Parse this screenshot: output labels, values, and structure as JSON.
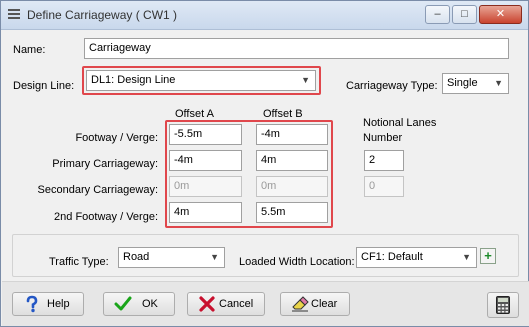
{
  "window": {
    "title": "Define Carriageway ( CW1 )",
    "caption_buttons": {
      "minimize": "–",
      "maximize": "□",
      "close": "✕"
    }
  },
  "name": {
    "label": "Name:",
    "value": "Carriageway"
  },
  "design_line": {
    "label": "Design Line:",
    "value": "DL1: Design Line"
  },
  "carriageway_type": {
    "label": "Carriageway Type:",
    "value": "Single"
  },
  "columns": {
    "offset_a": "Offset A",
    "offset_b": "Offset B",
    "notional_lanes": "Notional Lanes",
    "notional_number": "Number"
  },
  "rows": [
    {
      "label": "Footway / Verge:",
      "offset_a": "-5.5m",
      "offset_b": "-4m",
      "lanes": ""
    },
    {
      "label": "Primary Carriageway:",
      "offset_a": "-4m",
      "offset_b": "4m",
      "lanes": "2"
    },
    {
      "label": "Secondary Carriageway:",
      "offset_a": "0m",
      "offset_b": "0m",
      "lanes": "0"
    },
    {
      "label": "2nd Footway / Verge:",
      "offset_a": "4m",
      "offset_b": "5.5m",
      "lanes": ""
    }
  ],
  "traffic_type": {
    "label": "Traffic Type:",
    "value": "Road"
  },
  "loaded_width": {
    "label": "Loaded Width Location:",
    "value": "CF1: Default",
    "add": "+"
  },
  "buttons": {
    "help": "Help",
    "ok": "OK",
    "cancel": "Cancel",
    "clear": "Clear"
  },
  "icons": {
    "app": "menu-lines-icon",
    "help": "question-icon",
    "ok": "check-icon",
    "cancel": "x-icon",
    "clear": "eraser-icon",
    "calc": "calculator-icon"
  },
  "colors": {
    "highlight": "#e0474c",
    "ok_green": "#1aa51a",
    "cancel_red": "#c8102e",
    "help_blue": "#2457c5"
  }
}
